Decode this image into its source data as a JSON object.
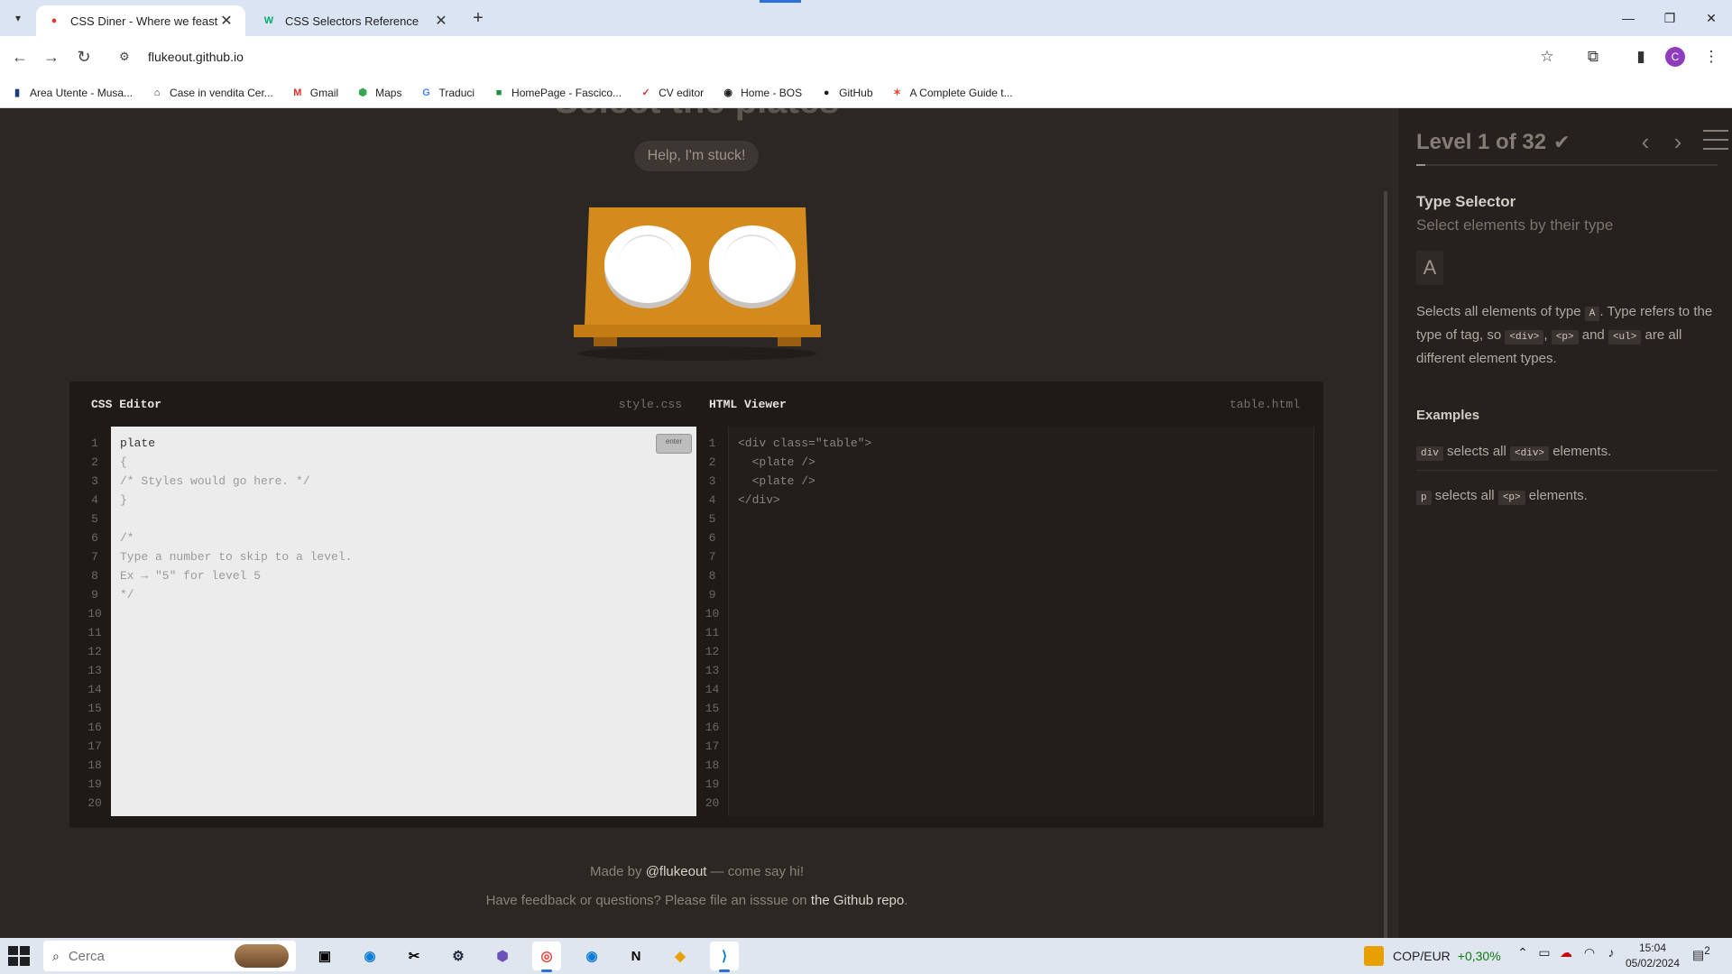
{
  "browser": {
    "tabs": [
      {
        "title": "CSS Diner - Where we feast on",
        "favicon": "red-dot-icon",
        "active": true
      },
      {
        "title": "CSS Selectors Reference",
        "favicon": "w3schools-icon",
        "active": false
      }
    ],
    "url": "flukeout.github.io",
    "bookmarks": [
      {
        "label": "Area Utente - Musa...",
        "icon": "musa-icon"
      },
      {
        "label": "Case in vendita Cer...",
        "icon": "house-icon"
      },
      {
        "label": "Gmail",
        "icon": "gmail-icon"
      },
      {
        "label": "Maps",
        "icon": "maps-icon"
      },
      {
        "label": "Traduci",
        "icon": "translate-icon"
      },
      {
        "label": "HomePage - Fascico...",
        "icon": "fascicolo-icon"
      },
      {
        "label": "CV editor",
        "icon": "cv-icon"
      },
      {
        "label": "Home - BOS",
        "icon": "bos-icon"
      },
      {
        "label": "GitHub",
        "icon": "github-icon"
      },
      {
        "label": "A Complete Guide t...",
        "icon": "guide-icon"
      }
    ],
    "profile_initial": "C"
  },
  "game": {
    "title": "Select the plates",
    "help_button": "Help, I'm stuck!",
    "css_editor": {
      "title": "CSS Editor",
      "file": "style.css",
      "enter_label": "enter",
      "lines": [
        "plate",
        "{",
        "/* Styles would go here. */",
        "}",
        "",
        "/*",
        "Type a number to skip to a level.",
        "Ex → \"5\" for level 5",
        "*/",
        "",
        "",
        "",
        "",
        "",
        "",
        "",
        "",
        "",
        "",
        ""
      ]
    },
    "html_viewer": {
      "title": "HTML Viewer",
      "file": "table.html",
      "lines": [
        "<div class=\"table\">",
        "  <plate />",
        "  <plate />",
        "</div>",
        "",
        "",
        "",
        "",
        "",
        "",
        "",
        "",
        "",
        "",
        "",
        "",
        "",
        "",
        "",
        ""
      ]
    },
    "footer": {
      "made_by_prefix": "Made by ",
      "made_by_link": "@flukeout",
      "made_by_suffix": " — come say hi!",
      "feedback_prefix": "Have feedback or questions? Please file an isssue on ",
      "feedback_link": "the Github repo",
      "feedback_suffix": "."
    }
  },
  "sidebar": {
    "level_text": "Level 1 of 32",
    "progress_fraction": 0.03125,
    "selector_name": "Type Selector",
    "selector_subtitle": "Select elements by their type",
    "syntax": "A",
    "desc_1": "Selects all elements of type ",
    "desc_code_a": "A",
    "desc_2": ". Type refers to the type of tag, so ",
    "desc_code_div": "<div>",
    "desc_3": ", ",
    "desc_code_p": "<p>",
    "desc_4": " and ",
    "desc_code_ul": "<ul>",
    "desc_5": " are all different element types.",
    "examples_title": "Examples",
    "examples": [
      {
        "code": "div",
        "text_1": " selects all ",
        "tag": "<div>",
        "text_2": " elements."
      },
      {
        "code": "p",
        "text_1": " selects all ",
        "tag": "<p>",
        "text_2": " elements."
      }
    ]
  },
  "taskbar": {
    "search_placeholder": "Cerca",
    "stock_pair": "COP/EUR",
    "stock_change": "+0,30%",
    "time": "15:04",
    "date": "05/02/2024",
    "notifications": "2"
  },
  "colors": {
    "page_bg": "#2b2723",
    "table": "#d48a1d",
    "editor_light": "#ececec",
    "accent": "#2a6fdb"
  }
}
